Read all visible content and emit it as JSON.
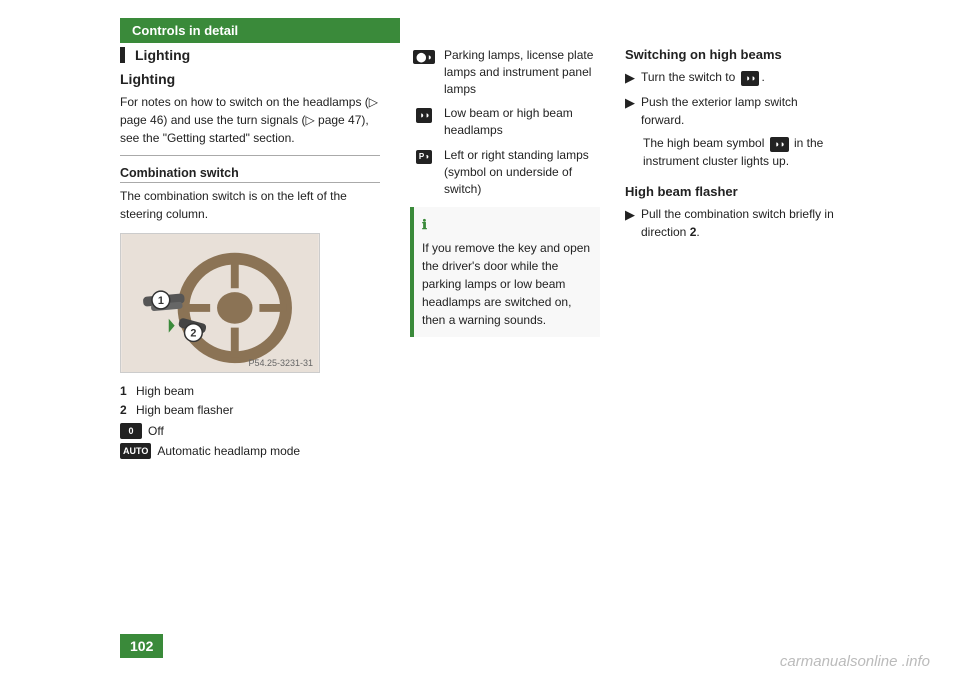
{
  "header": {
    "section": "Controls in detail"
  },
  "left": {
    "lighting_label": "Lighting",
    "lighting_subtitle": "Lighting",
    "body_text": "For notes on how to switch on the headlamps (▷ page 46) and use the turn signals (▷ page 47), see the \"Getting started\" section.",
    "combination_switch_heading": "Combination switch",
    "combination_switch_text": "The combination switch is on the left of the steering column.",
    "image_label": "P54.25-3231-31",
    "caption_1_num": "1",
    "caption_1_text": "High beam",
    "caption_2_num": "2",
    "caption_2_text": "High beam flasher",
    "badge_0_label": "0",
    "badge_0_desc": "Off",
    "badge_auto_label": "AUTO",
    "badge_auto_desc": "Automatic headlamp mode"
  },
  "middle": {
    "sym1_icon": "🔆",
    "sym1_icon_label": "⬤◑",
    "sym1_text": "Parking lamps, license plate lamps and instrument panel lamps",
    "sym2_icon_label": "◑◑",
    "sym2_text": "Low beam or high beam headlamps",
    "sym3_icon_label": "P◑",
    "sym3_text": "Left or right standing lamps (symbol on underside of switch)",
    "info_icon": "ℹ",
    "info_text": "If you remove the key and open the driver's door while the parking lamps or low beam headlamps are switched on, then a warning sounds."
  },
  "right": {
    "high_beams_heading": "Switching on high beams",
    "bullet1_text_before": "Turn the switch to",
    "bullet1_badge": "◑◑",
    "bullet2_text": "Push the exterior lamp switch forward.",
    "note_text_before": "The high beam symbol",
    "note_badge": "◑◑",
    "note_text_after": "in the instrument cluster lights up.",
    "high_beam_flasher_heading": "High beam flasher",
    "flasher_bullet_text": "Pull the combination switch briefly in direction",
    "flasher_direction": "2",
    "flasher_period": "."
  },
  "footer": {
    "page_number": "102"
  },
  "watermark": "carmanualsonline .info"
}
